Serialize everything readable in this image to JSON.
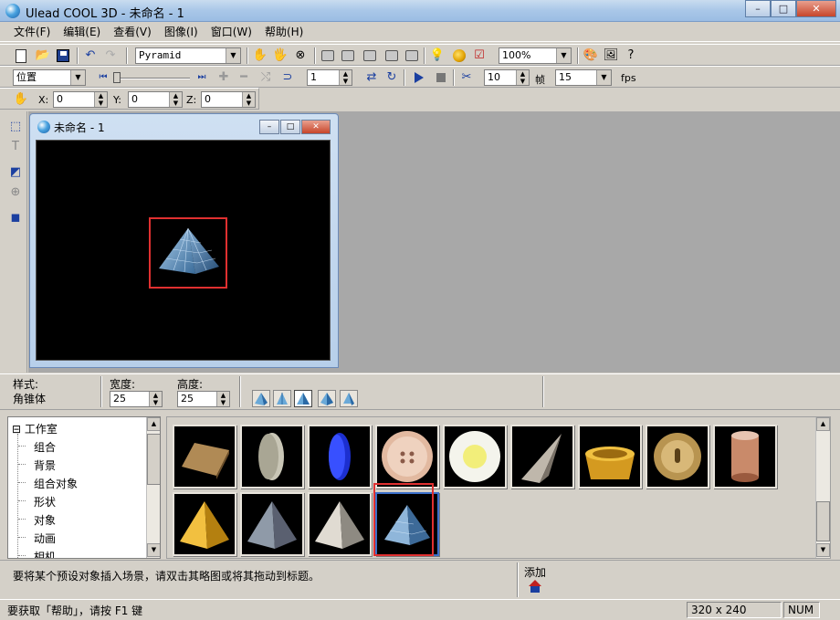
{
  "window": {
    "title": "Ulead COOL 3D - 未命名 - 1",
    "minimize": "–",
    "maximize": "□",
    "close": "✕"
  },
  "menu": [
    "文件(F)",
    "编辑(E)",
    "查看(V)",
    "图像(I)",
    "窗口(W)",
    "帮助(H)"
  ],
  "toolbar1": {
    "object_select": "Pyramid",
    "zoom_select": "100%"
  },
  "toolbar2": {
    "mode_select": "位置",
    "frame_value": "1",
    "frames_value": "10",
    "frames_label": "帧",
    "fps_value": "15",
    "fps_label": "fps"
  },
  "toolbar3": {
    "x_label": "X:",
    "x_value": "0",
    "y_label": "Y:",
    "y_value": "0",
    "z_label": "Z:",
    "z_value": "0"
  },
  "child_window": {
    "title": "未命名 - 1"
  },
  "properties": {
    "style_label": "样式:",
    "style_value": "角锥体",
    "width_label": "宽度:",
    "width_value": "25",
    "height_label": "高度:",
    "height_value": "25"
  },
  "tree": {
    "root": "工作室",
    "items": [
      "组合",
      "背景",
      "组合对象",
      "形状",
      "对象",
      "动画",
      "相机"
    ],
    "expand_glyph": "⊟"
  },
  "thumbnails": [
    {
      "name": "cork-board"
    },
    {
      "name": "stone-coin"
    },
    {
      "name": "blue-disc"
    },
    {
      "name": "button"
    },
    {
      "name": "egg"
    },
    {
      "name": "cone"
    },
    {
      "name": "dog-bowl"
    },
    {
      "name": "lock"
    },
    {
      "name": "spool"
    },
    {
      "name": "gold-pyramid"
    },
    {
      "name": "marble-pyramid"
    },
    {
      "name": "silver-pyramid"
    },
    {
      "name": "glass-pyramid"
    }
  ],
  "infobar": {
    "hint": "要将某个预设对象插入场景，请双击其略图或将其拖动到标题。",
    "add_label": "添加"
  },
  "statusbar": {
    "help": "要获取「帮助」，请按 F1 键",
    "size": "320 x 240",
    "num": "NUM"
  },
  "colors": {
    "highlight": "#e03030",
    "canvas": "#000000",
    "workspace": "#a8a8a8"
  }
}
